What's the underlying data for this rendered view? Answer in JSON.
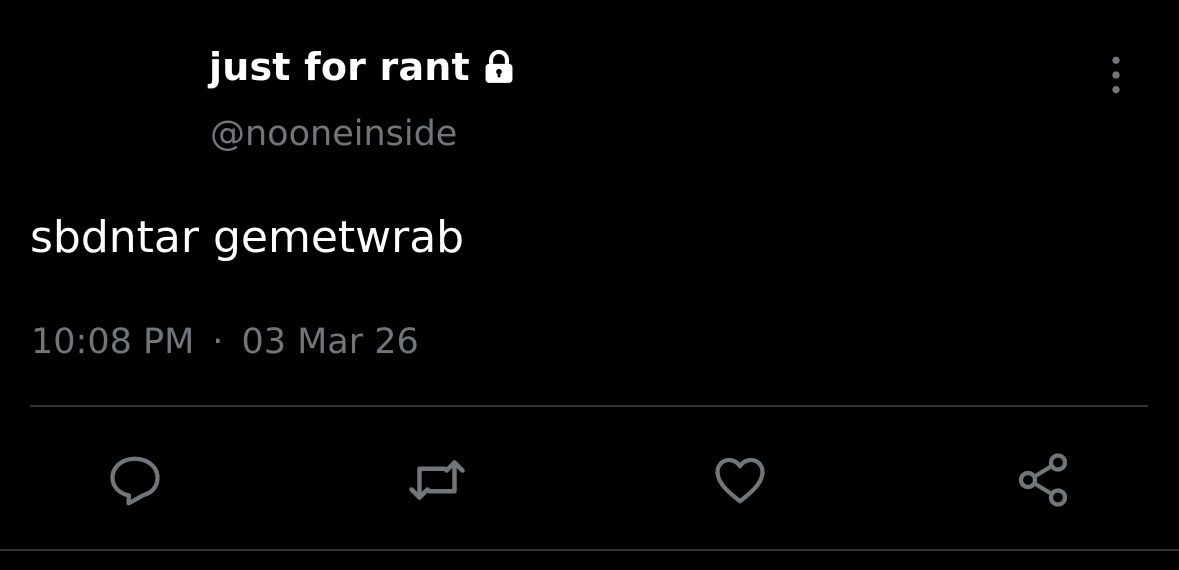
{
  "tweet": {
    "display_name": "just for rant",
    "handle": "@nooneinside",
    "text": "sbdntar gemetwrab",
    "time": "10:08 PM",
    "separator": "·",
    "date": "03 Mar 26"
  },
  "icons": {
    "lock": "lock-icon",
    "more": "more-vertical-icon",
    "reply": "reply-icon",
    "retweet": "retweet-icon",
    "like": "heart-icon",
    "share": "share-icon"
  },
  "colors": {
    "background": "#000000",
    "primary_text": "#ffffff",
    "secondary_text": "#71767b",
    "divider": "#2f3336",
    "icon": "#71767b"
  }
}
